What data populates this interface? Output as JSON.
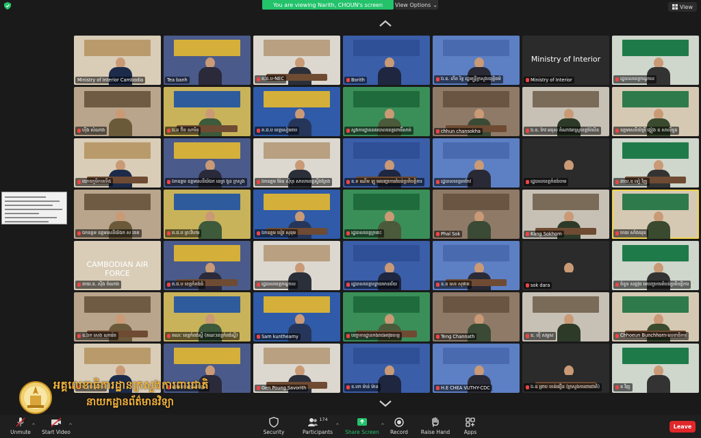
{
  "top": {
    "banner": "You are viewing Narith, CHOUN's screen",
    "view_options": "View Options",
    "view": "View"
  },
  "participants": [
    {
      "name": "Ministry of Interior Cambodia",
      "muted": false
    },
    {
      "name": "Tea banh",
      "muted": false
    },
    {
      "name": "គ.ជ.ប-NEC",
      "muted": true
    },
    {
      "name": "Borith",
      "muted": true
    },
    {
      "name": "ឯ.ឧ. កើត រិទ្ធ រដ្ឋមន្ត្រីក្រសួងយុត្តិធម៌",
      "muted": true
    },
    {
      "name": "Ministry of Interior",
      "muted": true,
      "center_text": "Ministry of Interior"
    },
    {
      "name": "រដ្ឋបាលខេត្តកណ្តាល",
      "muted": true
    },
    {
      "name": "ហ៊ីង សំណាង",
      "muted": true
    },
    {
      "name": "ឯ.ឧ ប៊ិន ណារិន",
      "muted": true
    },
    {
      "name": "គ.ជ.ប ខេត្តសៀមរាប",
      "muted": true
    },
    {
      "name": "ស្នងការដ្ឋាននគរបាលខេត្តពោធិ៍សាត់",
      "muted": true
    },
    {
      "name": "chhun chansokha",
      "muted": true
    },
    {
      "name": "ឯ.ឧ. កែវ អនុស តំណាងរាស្ត្រខេត្តប៉ៃលិន",
      "muted": true
    },
    {
      "name": "ឧត្តមសេនីយ៍ត្រី ង្វៀង ឧ សាលីនួន",
      "muted": true
    },
    {
      "name": "យោធភូមិភាគទី៥",
      "muted": true
    },
    {
      "name": "ឯកឧត្តម ឧត្តមសេនីយ៍ឯក នេត្រ ងួន ក្រសួង",
      "muted": true
    },
    {
      "name": "ឯកឧត្តម ម៉ែន ស៊ីបុរ សាលាខេត្តស្ទឹងត្រែង",
      "muted": true
    },
    {
      "name": "ឧ.ទ ណើម ឡូ មេបញ្ជាការតំបន់ប្រតិបត្តិការ",
      "muted": true
    },
    {
      "name": "រដ្ឋបាលខេត្តតាកែវ",
      "muted": true
    },
    {
      "name": "រដ្ឋបាលខេត្តកំពង់ចាម",
      "muted": true
    },
    {
      "name": "នាយ.ឧ ទៀ វិញ",
      "muted": true
    },
    {
      "name": "ឯកឧត្តម ឧត្តមសេនីយ៍ឯក ស ចេត",
      "muted": true
    },
    {
      "name": "គ.ជ.ប ព្រះវិហារ",
      "muted": true
    },
    {
      "name": "ឯកឧត្តម បៀវ សុខុម",
      "muted": true
    },
    {
      "name": "រដ្ឋបាលខេត្តក្រចេះ",
      "muted": true
    },
    {
      "name": "Phal Sok",
      "muted": true
    },
    {
      "name": "Kang Sokhorn",
      "muted": true
    },
    {
      "name": "ចាយ សាំងយុន",
      "muted": true
    },
    {
      "name": "នាយ.ឧ. ស៊ីង ចំណាង",
      "muted": true,
      "center_text": "CAMBODIAN AIR FORCE"
    },
    {
      "name": "គ.ជ.ប ខេត្តកំពង់ធំ",
      "muted": true
    },
    {
      "name": "រដ្ឋបាលខេត្តកណ្តាល",
      "muted": true
    },
    {
      "name": "រដ្ឋបាលខេត្តបន្ទាយមានជ័យ",
      "muted": true
    },
    {
      "name": "ឧ.ឧ សេរ សុផាត",
      "muted": true
    },
    {
      "name": "sok dara",
      "muted": true
    },
    {
      "name": "ចំនួន សត្វវុធ មេបញ្ជាការតំបន់ប្រតិបត្តិការ",
      "muted": true
    },
    {
      "name": "ឧ.ឯក សេង ណារ៉េត",
      "muted": true
    },
    {
      "name": "គណៈ ខេត្តកំពង់ស្ពឺ (គណៈខេត្តកំពង់ស្ពឺ)",
      "muted": true
    },
    {
      "name": "Sam kuntheamy",
      "muted": true
    },
    {
      "name": "បញ្ជាការដ្ឋានកងរាជអាវុធហត្ថ",
      "muted": true
    },
    {
      "name": "Teng Channath",
      "muted": true
    },
    {
      "name": "ឧ. ហ៊ី សម្ផស",
      "muted": true
    },
    {
      "name": "Chhoeun Bunchhorn-លេខាធិការ",
      "muted": true
    },
    {
      "name": "ខេត្តសៀមរាប",
      "muted": true
    },
    {
      "name": "រដ្ឋបាលខេត្តកំពង់ឆ្នាំង",
      "muted": true
    },
    {
      "name": "Gen Poung Savorith",
      "muted": true
    },
    {
      "name": "ឧ.ទោ ម៉ាន់ ម៉ាន",
      "muted": true
    },
    {
      "name": "H.E CHEA VUTHY-CDC",
      "muted": true
    },
    {
      "name": "ឯ.ឧ ព្រាប ចាន់ធឿន (ក្រសួងការពារជាតិ)",
      "muted": true
    },
    {
      "name": "ឧ វិញ",
      "muted": true
    }
  ],
  "watermark": {
    "line1": "អគ្គលេខាធិការដ្ឋានក្រសួងការពារជាតិ",
    "line2": "នាយកដ្ឋានព័ត៌មានវិទ្យា"
  },
  "toolbar": {
    "unmute": "Unmute",
    "start_video": "Start Video",
    "security": "Security",
    "participants": "Participants",
    "participants_count": "174",
    "share_screen": "Share Screen",
    "record": "Record",
    "raise_hand": "Raise Hand",
    "apps": "Apps",
    "leave": "Leave"
  },
  "colors": {
    "banner_green": "#23c26b",
    "share_green": "#23c26b",
    "leave_red": "#e0272a",
    "watermark_gold": "#f0b23a"
  }
}
